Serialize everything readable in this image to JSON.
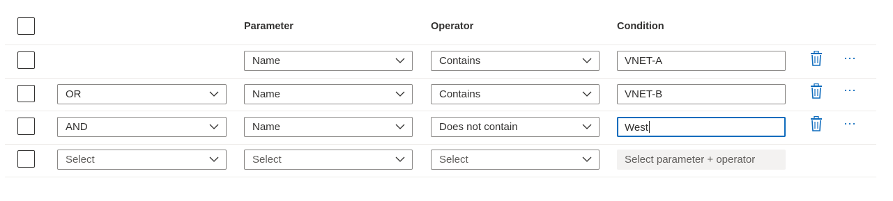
{
  "headers": {
    "parameter": "Parameter",
    "operator": "Operator",
    "condition": "Condition"
  },
  "rows": [
    {
      "parameter": "Name",
      "operator": "Contains",
      "condition": "VNET-A"
    },
    {
      "andor": "OR",
      "parameter": "Name",
      "operator": "Contains",
      "condition": "VNET-B"
    },
    {
      "andor": "AND",
      "parameter": "Name",
      "operator": "Does not contain",
      "condition": "West"
    },
    {
      "andor": "Select",
      "parameter": "Select",
      "operator": "Select",
      "condition_placeholder": "Select parameter + operator"
    }
  ],
  "icons": {
    "trash": "trash-icon",
    "more": "more-icon",
    "chevron": "chevron-down-icon"
  },
  "colors": {
    "accent": "#0f6cbd",
    "text": "#323130",
    "border": "#8a8886",
    "separator": "#edebe9",
    "disabled_bg": "#f3f2f1"
  }
}
